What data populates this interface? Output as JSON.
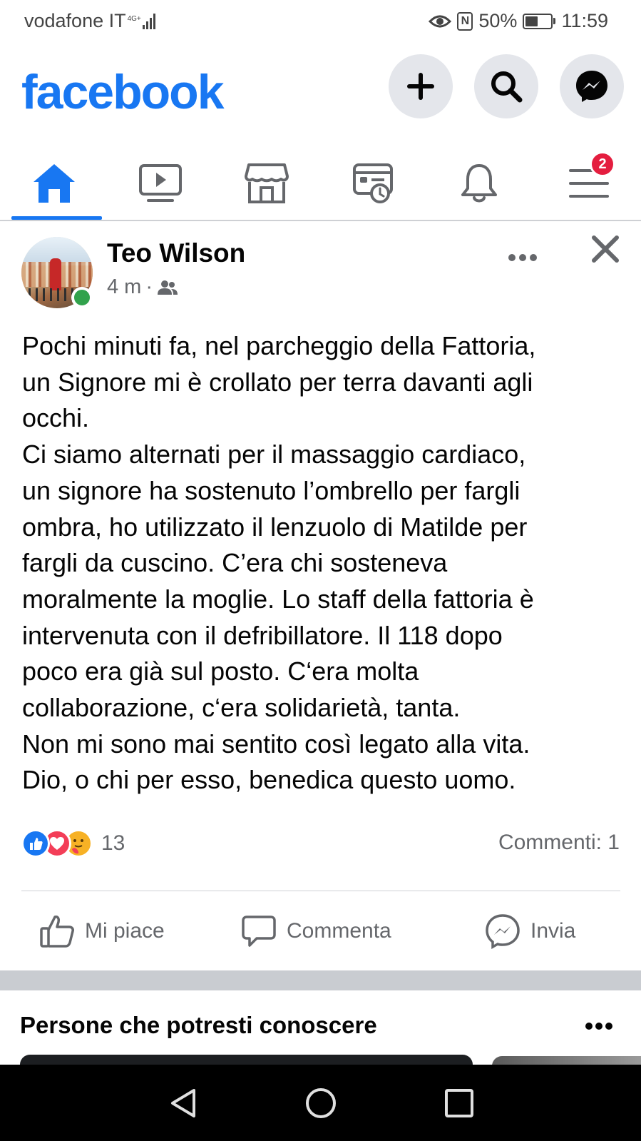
{
  "status_bar": {
    "carrier": "vodafone IT",
    "network": "4G+",
    "battery": "50%",
    "battery_level": 0.5,
    "time": "11:59"
  },
  "header": {
    "logo": "facebook",
    "buttons": [
      "plus-icon",
      "search-icon",
      "messenger-icon"
    ]
  },
  "tabs": [
    {
      "name": "home",
      "icon": "home-icon",
      "active": true
    },
    {
      "name": "watch",
      "icon": "video-icon"
    },
    {
      "name": "marketplace",
      "icon": "store-icon"
    },
    {
      "name": "memories",
      "icon": "memories-icon"
    },
    {
      "name": "notifications",
      "icon": "bell-icon"
    },
    {
      "name": "menu",
      "icon": "menu-icon",
      "badge": "2"
    }
  ],
  "post": {
    "author": "Teo Wilson",
    "time": "4 m",
    "separator": "·",
    "audience_icon": "friends-icon",
    "text": "Pochi minuti fa, nel parcheggio della Fattoria,\nun Signore mi è crollato per terra davanti agli\nocchi.\nCi siamo alternati per il massaggio cardiaco,\nun signore ha sostenuto l’ombrello per fargli\nombra, ho utilizzato il lenzuolo di Matilde per\nfargli da cuscino. C’era chi sosteneva\nmoralmente la moglie. Lo staff della fattoria è\nintervenuta con il defribillatore. Il 118 dopo\npoco era già sul posto. C‘era molta\ncollaborazione, c‘era solidarietà, tanta.\nNon mi sono mai sentito così legato alla vita.\nDio, o chi per esso, benedica questo uomo.",
    "reaction_count": "13",
    "comments": "Commenti: 1",
    "actions": {
      "like": "Mi piace",
      "comment": "Commenta",
      "send": "Invia"
    }
  },
  "pymk": {
    "title": "Persone che potresti conoscere"
  },
  "colors": {
    "brand": "#1877f2",
    "badge": "#e41e3f",
    "online": "#31a24c",
    "secondary_text": "#65676b"
  }
}
